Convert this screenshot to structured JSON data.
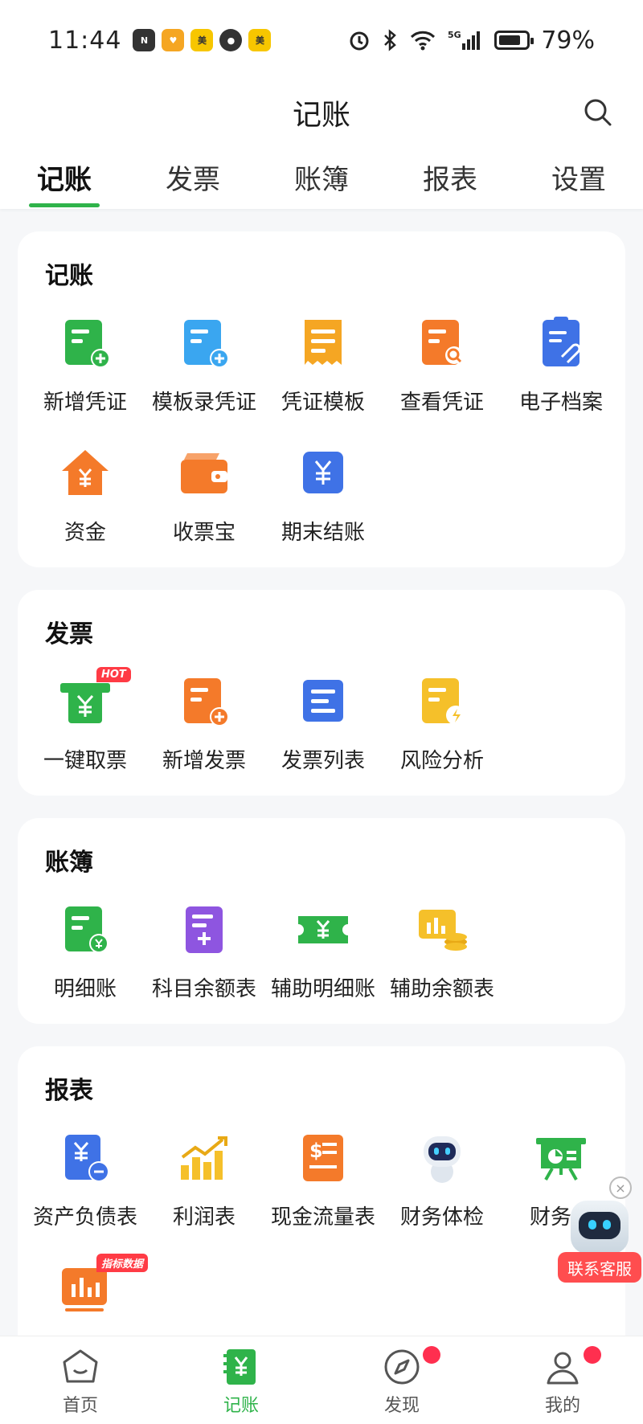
{
  "status_bar": {
    "time": "11:44",
    "battery": "79%",
    "signal": "5G"
  },
  "header": {
    "title": "记账"
  },
  "tabs": [
    {
      "label": "记账",
      "active": true
    },
    {
      "label": "发票",
      "active": false
    },
    {
      "label": "账簿",
      "active": false
    },
    {
      "label": "报表",
      "active": false
    },
    {
      "label": "设置",
      "active": false
    }
  ],
  "sections": [
    {
      "title": "记账",
      "items": [
        {
          "label": "新增凭证",
          "icon": "voucher-add-icon",
          "color": "#2fb34a"
        },
        {
          "label": "模板录凭证",
          "icon": "template-voucher-icon",
          "color": "#3aa6f0"
        },
        {
          "label": "凭证模板",
          "icon": "voucher-template-icon",
          "color": "#f5a623"
        },
        {
          "label": "查看凭证",
          "icon": "voucher-search-icon",
          "color": "#f47a2a"
        },
        {
          "label": "电子档案",
          "icon": "e-archive-icon",
          "color": "#3f72e6"
        },
        {
          "label": "资金",
          "icon": "house-yuan-icon",
          "color": "#f47a2a"
        },
        {
          "label": "收票宝",
          "icon": "wallet-icon",
          "color": "#f47a2a"
        },
        {
          "label": "期末结账",
          "icon": "yuan-square-icon",
          "color": "#3f72e6"
        }
      ]
    },
    {
      "title": "发票",
      "items": [
        {
          "label": "一键取票",
          "icon": "invoice-fetch-icon",
          "color": "#2fb34a",
          "badge": "HOT"
        },
        {
          "label": "新增发票",
          "icon": "invoice-add-icon",
          "color": "#f47a2a"
        },
        {
          "label": "发票列表",
          "icon": "invoice-list-icon",
          "color": "#3f72e6"
        },
        {
          "label": "风险分析",
          "icon": "risk-analysis-icon",
          "color": "#f5c02a"
        }
      ]
    },
    {
      "title": "账簿",
      "items": [
        {
          "label": "明细账",
          "icon": "detail-ledger-icon",
          "color": "#2fb34a"
        },
        {
          "label": "科目余额表",
          "icon": "account-balance-icon",
          "color": "#8e55e0"
        },
        {
          "label": "辅助明细账",
          "icon": "aux-ticket-icon",
          "color": "#2fb34a"
        },
        {
          "label": "辅助余额表",
          "icon": "aux-balance-icon",
          "color": "#f5c02a"
        }
      ]
    },
    {
      "title": "报表",
      "items": [
        {
          "label": "资产负债表",
          "icon": "balance-sheet-icon",
          "color": "#3f72e6"
        },
        {
          "label": "利润表",
          "icon": "profit-chart-icon",
          "color": "#f5c02a"
        },
        {
          "label": "现金流量表",
          "icon": "cashflow-icon",
          "color": "#f47a2a"
        },
        {
          "label": "财务体检",
          "icon": "robot-icon",
          "color": "#3f72e6"
        },
        {
          "label": "财务分",
          "icon": "presentation-icon",
          "color": "#2fb34a"
        },
        {
          "label": "",
          "icon": "indicator-data-icon",
          "color": "#f47a2a",
          "badge": "指标数据"
        }
      ]
    }
  ],
  "fab": {
    "label": "联系客服",
    "close": "×"
  },
  "bottom_nav": [
    {
      "label": "首页",
      "icon": "home-icon",
      "active": false,
      "dot": false
    },
    {
      "label": "记账",
      "icon": "ledger-yuan-icon",
      "active": true,
      "dot": false
    },
    {
      "label": "发现",
      "icon": "compass-icon",
      "active": false,
      "dot": true
    },
    {
      "label": "我的",
      "icon": "user-icon",
      "active": false,
      "dot": true
    }
  ]
}
